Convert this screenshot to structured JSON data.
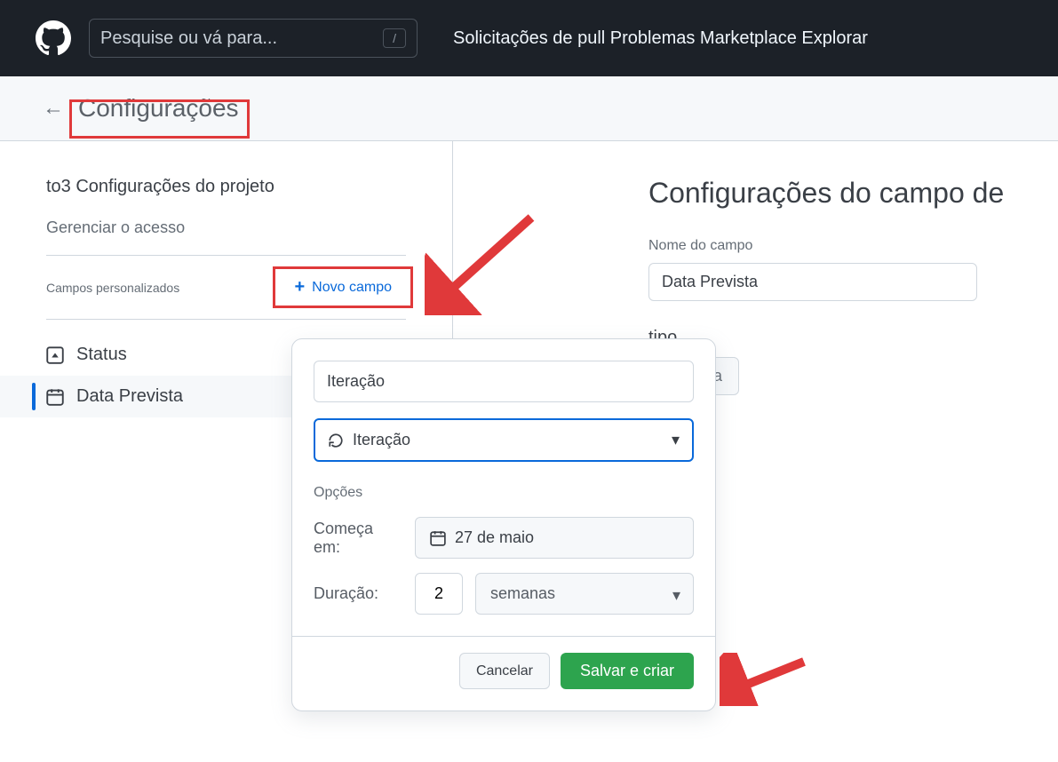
{
  "header": {
    "search_placeholder": "Pesquise ou vá para...",
    "slash": "/",
    "nav_text": "Solicitações de pull Problemas Marketplace Explorar"
  },
  "page": {
    "title": "Configurações"
  },
  "sidebar": {
    "section_heading": "to3 Configurações do projeto",
    "manage_access": "Gerenciar o acesso",
    "custom_fields_label": "Campos personalizados",
    "new_field_label": "Novo campo",
    "items": [
      {
        "label": "Status"
      },
      {
        "label": "Data Prevista"
      }
    ]
  },
  "main": {
    "title": "Configurações do campo de",
    "field_name_label": "Nome do campo",
    "field_name_value": "Data Prevista",
    "type_label": "tipo",
    "type_value": "Data"
  },
  "popup": {
    "name_value": "Iteração",
    "type_value": "Iteração",
    "options_label": "Opções",
    "start_label": "Começa em:",
    "start_value": "27 de maio",
    "duration_label": "Duração:",
    "duration_value": "2",
    "duration_unit": "semanas",
    "cancel": "Cancelar",
    "save": "Salvar e criar"
  }
}
